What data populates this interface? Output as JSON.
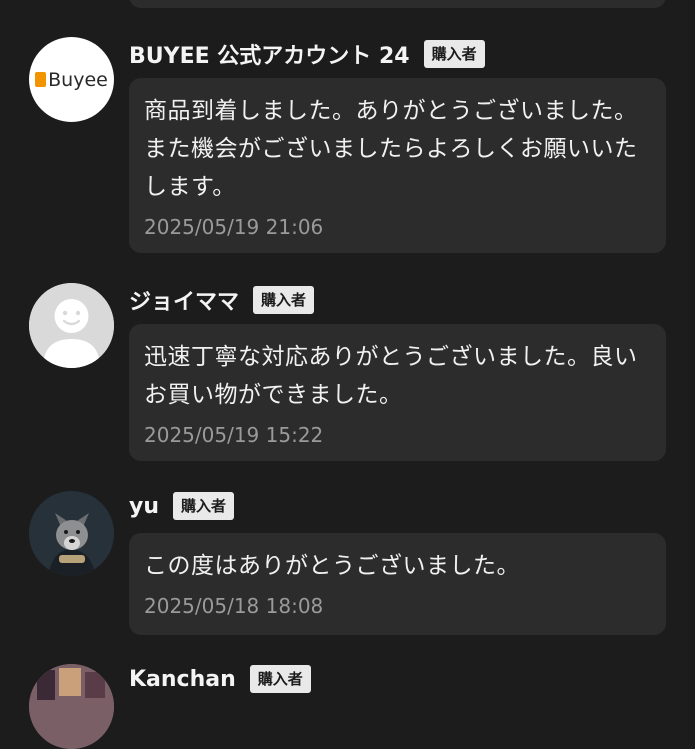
{
  "comments": [
    {
      "name": "BUYEE 公式アカウント 24",
      "badge": "購入者",
      "message": "商品到着しました。ありがとうございました。また機会がございましたらよろしくお願いいたします。",
      "timestamp": "2025/05/19 21:06",
      "avatar": {
        "type": "logo",
        "logo_text": "Buyee",
        "logo_color": "#f29400"
      }
    },
    {
      "name": "ジョイママ",
      "badge": "購入者",
      "message": "迅速丁寧な対応ありがとうございました。良いお買い物ができました。",
      "timestamp": "2025/05/19 15:22",
      "avatar": {
        "type": "default"
      }
    },
    {
      "name": "yu",
      "badge": "購入者",
      "message": "この度はありがとうございました。",
      "timestamp": "2025/05/18 18:08",
      "avatar": {
        "type": "photo"
      }
    },
    {
      "name": "Kanchan",
      "badge": "購入者",
      "avatar": {
        "type": "photo"
      }
    }
  ],
  "colors": {
    "background": "#1c1c1c",
    "bubble": "#2c2c2c",
    "badge_bg": "#e9e9e9",
    "timestamp": "#9a9a9a"
  }
}
